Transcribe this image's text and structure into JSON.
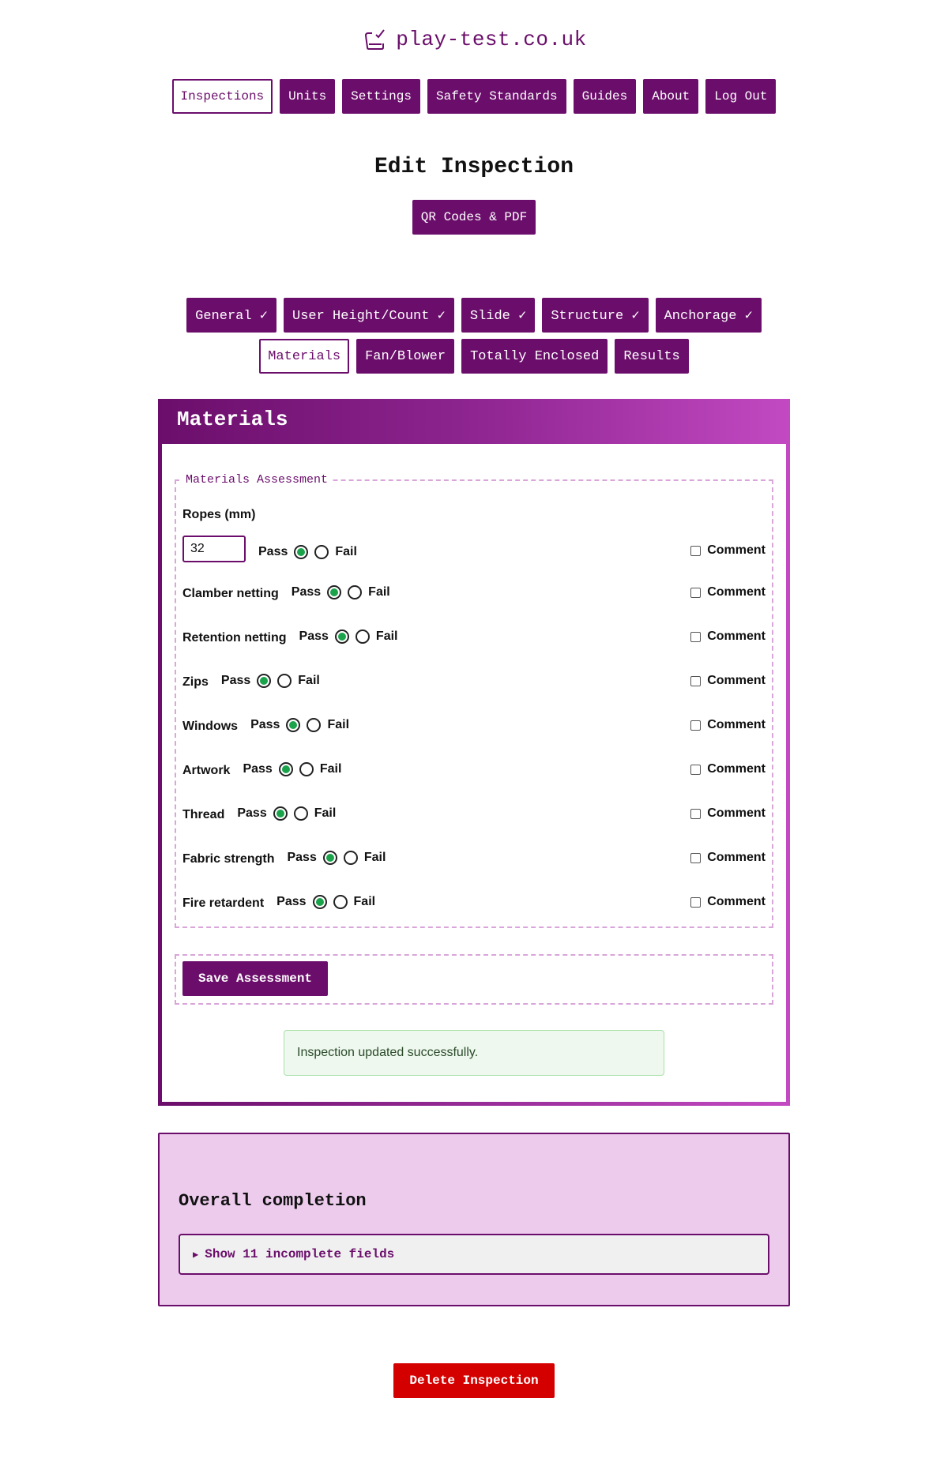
{
  "brand": {
    "name": "play-test.co.uk",
    "icon": "inspection-clipboard-icon"
  },
  "nav": [
    {
      "label": "Inspections",
      "active": true
    },
    {
      "label": "Units"
    },
    {
      "label": "Settings"
    },
    {
      "label": "Safety Standards"
    },
    {
      "label": "Guides"
    },
    {
      "label": "About"
    },
    {
      "label": "Log Out"
    }
  ],
  "page": {
    "title": "Edit Inspection",
    "qr_button": "QR Codes & PDF"
  },
  "tabs": [
    {
      "label": "General ✓"
    },
    {
      "label": "User Height/Count ✓"
    },
    {
      "label": "Slide ✓"
    },
    {
      "label": "Structure ✓"
    },
    {
      "label": "Anchorage ✓"
    },
    {
      "label": "Materials",
      "active": true
    },
    {
      "label": "Fan/Blower"
    },
    {
      "label": "Totally Enclosed"
    },
    {
      "label": "Results"
    }
  ],
  "materials": {
    "heading": "Materials",
    "legend": "Materials Assessment",
    "ropes_label": "Ropes (mm)",
    "ropes_value": "32",
    "pass_label": "Pass",
    "fail_label": "Fail",
    "comment_label": "Comment",
    "items": [
      {
        "label": "Clamber netting",
        "result": "pass"
      },
      {
        "label": "Retention netting",
        "result": "pass"
      },
      {
        "label": "Zips",
        "result": "pass"
      },
      {
        "label": "Windows",
        "result": "pass"
      },
      {
        "label": "Artwork",
        "result": "pass"
      },
      {
        "label": "Thread",
        "result": "pass"
      },
      {
        "label": "Fabric strength",
        "result": "pass"
      },
      {
        "label": "Fire retardent",
        "result": "pass"
      }
    ],
    "ropes_result": "pass",
    "save_button": "Save Assessment",
    "flash": "Inspection updated successfully."
  },
  "completion": {
    "heading": "Overall completion",
    "toggle": "Show 11 incomplete fields"
  },
  "delete_button": "Delete Inspection",
  "colors": {
    "brand": "#6b0e6b",
    "gradient_end": "#c249c2",
    "pass_green": "#1aa34a",
    "danger": "#d40000",
    "completion_bg": "#eccbec"
  }
}
